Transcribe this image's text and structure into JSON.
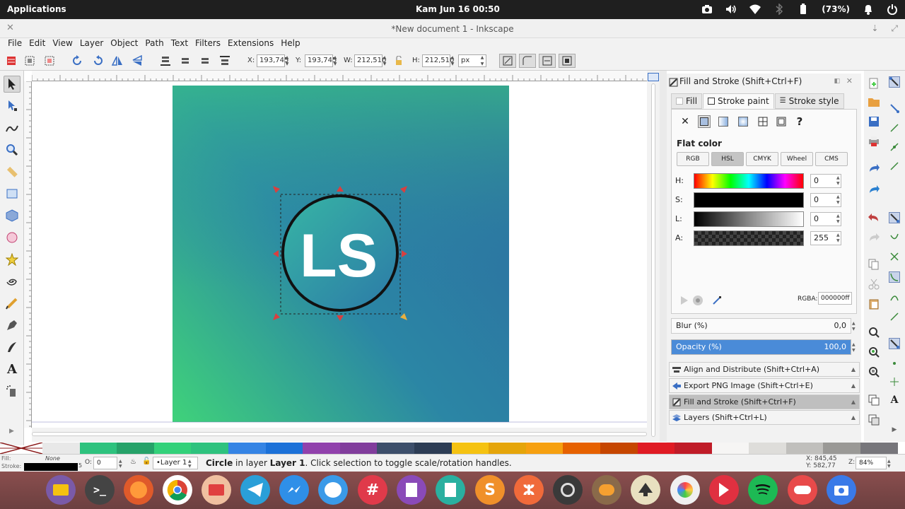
{
  "topbar": {
    "applications": "Applications",
    "clock": "Kam Jun 16   00:50",
    "battery": "(73%)"
  },
  "window": {
    "title": "*New document 1 - Inkscape"
  },
  "menu": [
    "File",
    "Edit",
    "View",
    "Layer",
    "Object",
    "Path",
    "Text",
    "Filters",
    "Extensions",
    "Help"
  ],
  "controls": {
    "x_label": "X:",
    "x_value": "193,745",
    "y_label": "Y:",
    "y_value": "193,745",
    "w_label": "W:",
    "w_value": "212,510",
    "h_label": "H:",
    "h_value": "212,510",
    "unit": "px"
  },
  "logo_text": "LS",
  "panel": {
    "title": "Fill and Stroke (Shift+Ctrl+F)",
    "tabs": [
      "Fill",
      "Stroke paint",
      "Stroke style"
    ],
    "flat_color": "Flat color",
    "modes": [
      "RGB",
      "HSL",
      "CMYK",
      "Wheel",
      "CMS"
    ],
    "sliders": [
      {
        "label": "H:",
        "value": "0"
      },
      {
        "label": "S:",
        "value": "0"
      },
      {
        "label": "L:",
        "value": "0"
      },
      {
        "label": "A:",
        "value": "255"
      }
    ],
    "rgba_label": "RGBA:",
    "rgba_value": "000000ff",
    "blur_label": "Blur (%)",
    "blur_value": "0,0",
    "opacity_label": "Opacity (%)",
    "opacity_value": "100,0",
    "opacity_fraction": 1.0,
    "docks": [
      "Align and Distribute (Shift+Ctrl+A)",
      "Export PNG Image (Shift+Ctrl+E)",
      "Fill and Stroke (Shift+Ctrl+F)",
      "Layers (Shift+Ctrl+L)"
    ]
  },
  "palette": [
    "#e8e8e8",
    "#2ec27e",
    "#26a269",
    "#33d17a",
    "#2ec27e",
    "#3584e4",
    "#1c71d8",
    "#9141ac",
    "#813d9c",
    "#3d4f6b",
    "#2d3d55",
    "#f5c211",
    "#e5a50a",
    "#f6a010",
    "#e66100",
    "#c64600",
    "#e01b24",
    "#c01c28",
    "#f6f5f4",
    "#deddda",
    "#c0bfbc",
    "#9a9996",
    "#77767b"
  ],
  "status": {
    "fill_label": "Fill:",
    "fill_value": "None",
    "stroke_label": "Stroke:",
    "stroke_width": "5",
    "opacity_label": "O:",
    "opacity_value": "0",
    "layer": "•Layer 1",
    "message_bold": "Circle",
    "message_mid": " in layer ",
    "message_layer": "Layer 1",
    "message_rest": ". Click selection to toggle scale/rotation handles.",
    "x_coord": "X:  845,45",
    "y_coord": "Y:  582,77",
    "zoom_label": "Z:",
    "zoom_value": "84%"
  },
  "dock_apps": [
    "files",
    "terminal",
    "firefox",
    "chrome",
    "mail",
    "telegram",
    "messenger",
    "signal",
    "slack",
    "docs",
    "sheets",
    "sublime",
    "xampp",
    "obs",
    "gimp",
    "inkscape",
    "pinwheel",
    "todo",
    "spotify",
    "toggle",
    "screenshot"
  ]
}
